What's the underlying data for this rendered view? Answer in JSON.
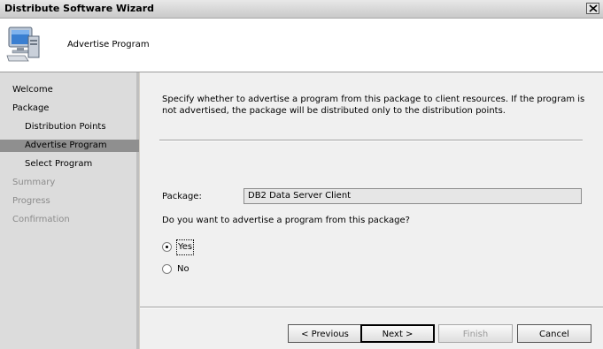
{
  "window": {
    "title": "Distribute Software Wizard"
  },
  "header": {
    "title": "Advertise Program",
    "icon": "computer-monitor-icon"
  },
  "nav": {
    "items": [
      {
        "label": "Welcome"
      },
      {
        "label": "Package"
      },
      {
        "label": "Distribution Points"
      },
      {
        "label": "Advertise Program"
      },
      {
        "label": "Select Program"
      },
      {
        "label": "Summary"
      },
      {
        "label": "Progress"
      },
      {
        "label": "Confirmation"
      }
    ],
    "selected": "Advertise Program"
  },
  "content": {
    "description": "Specify whether to advertise a program from this package to client resources.  If the program is not advertised, the package will be distributed only to the distribution points.",
    "package_label": "Package:",
    "package_value": "DB2 Data Server Client",
    "question": "Do you want to advertise a program from this package?",
    "options": [
      {
        "label": "Yes",
        "checked": true
      },
      {
        "label": "No",
        "checked": false
      }
    ]
  },
  "buttons": {
    "previous": "< Previous",
    "next": "Next >",
    "finish": "Finish",
    "cancel": "Cancel"
  }
}
